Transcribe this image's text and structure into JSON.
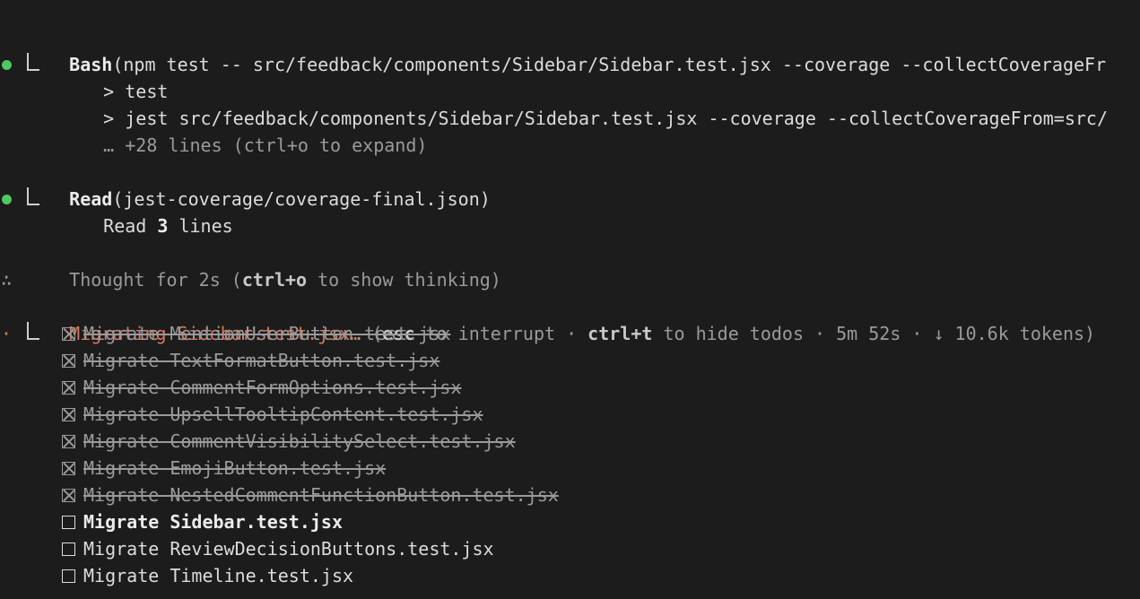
{
  "blocks": {
    "bash": {
      "tool": "Bash",
      "args": "(npm test -- src/feedback/components/Sidebar/Sidebar.test.jsx --coverage --collectCoverageFr",
      "out1": "> test",
      "out2": "> jest src/feedback/components/Sidebar/Sidebar.test.jsx --coverage --collectCoverageFrom=src/",
      "out3": "… +28 lines (ctrl+o to expand)"
    },
    "read": {
      "tool": "Read",
      "args": "(jest-coverage/coverage-final.json)",
      "result_prefix": "Read ",
      "result_count": "3",
      "result_suffix": " lines"
    },
    "thought": {
      "icon": "∴",
      "prefix": "Thought for 2s (",
      "key": "ctrl+o",
      "suffix": " to show thinking)"
    },
    "status": {
      "icon": "·",
      "task": "Migrating Sidebar.test.jsx…",
      "open": " (",
      "esc_key": "esc",
      "esc_text": " to interrupt · ",
      "todo_key": "ctrl+t",
      "todo_text": " to hide todos · 5m 52s · ↓ 10.6k tokens)"
    },
    "todos": [
      {
        "label": "Migrate MentionUserButton.test.jsx",
        "state": "done"
      },
      {
        "label": "Migrate TextFormatButton.test.jsx",
        "state": "done"
      },
      {
        "label": "Migrate CommentFormOptions.test.jsx",
        "state": "done"
      },
      {
        "label": "Migrate UpsellTooltipContent.test.jsx",
        "state": "done"
      },
      {
        "label": "Migrate CommentVisibilitySelect.test.jsx",
        "state": "done"
      },
      {
        "label": "Migrate EmojiButton.test.jsx",
        "state": "done"
      },
      {
        "label": "Migrate NestedCommentFunctionButton.test.jsx",
        "state": "done"
      },
      {
        "label": "Migrate Sidebar.test.jsx",
        "state": "active"
      },
      {
        "label": "Migrate ReviewDecisionButtons.test.jsx",
        "state": "pending"
      },
      {
        "label": "Migrate Timeline.test.jsx",
        "state": "pending"
      }
    ]
  }
}
